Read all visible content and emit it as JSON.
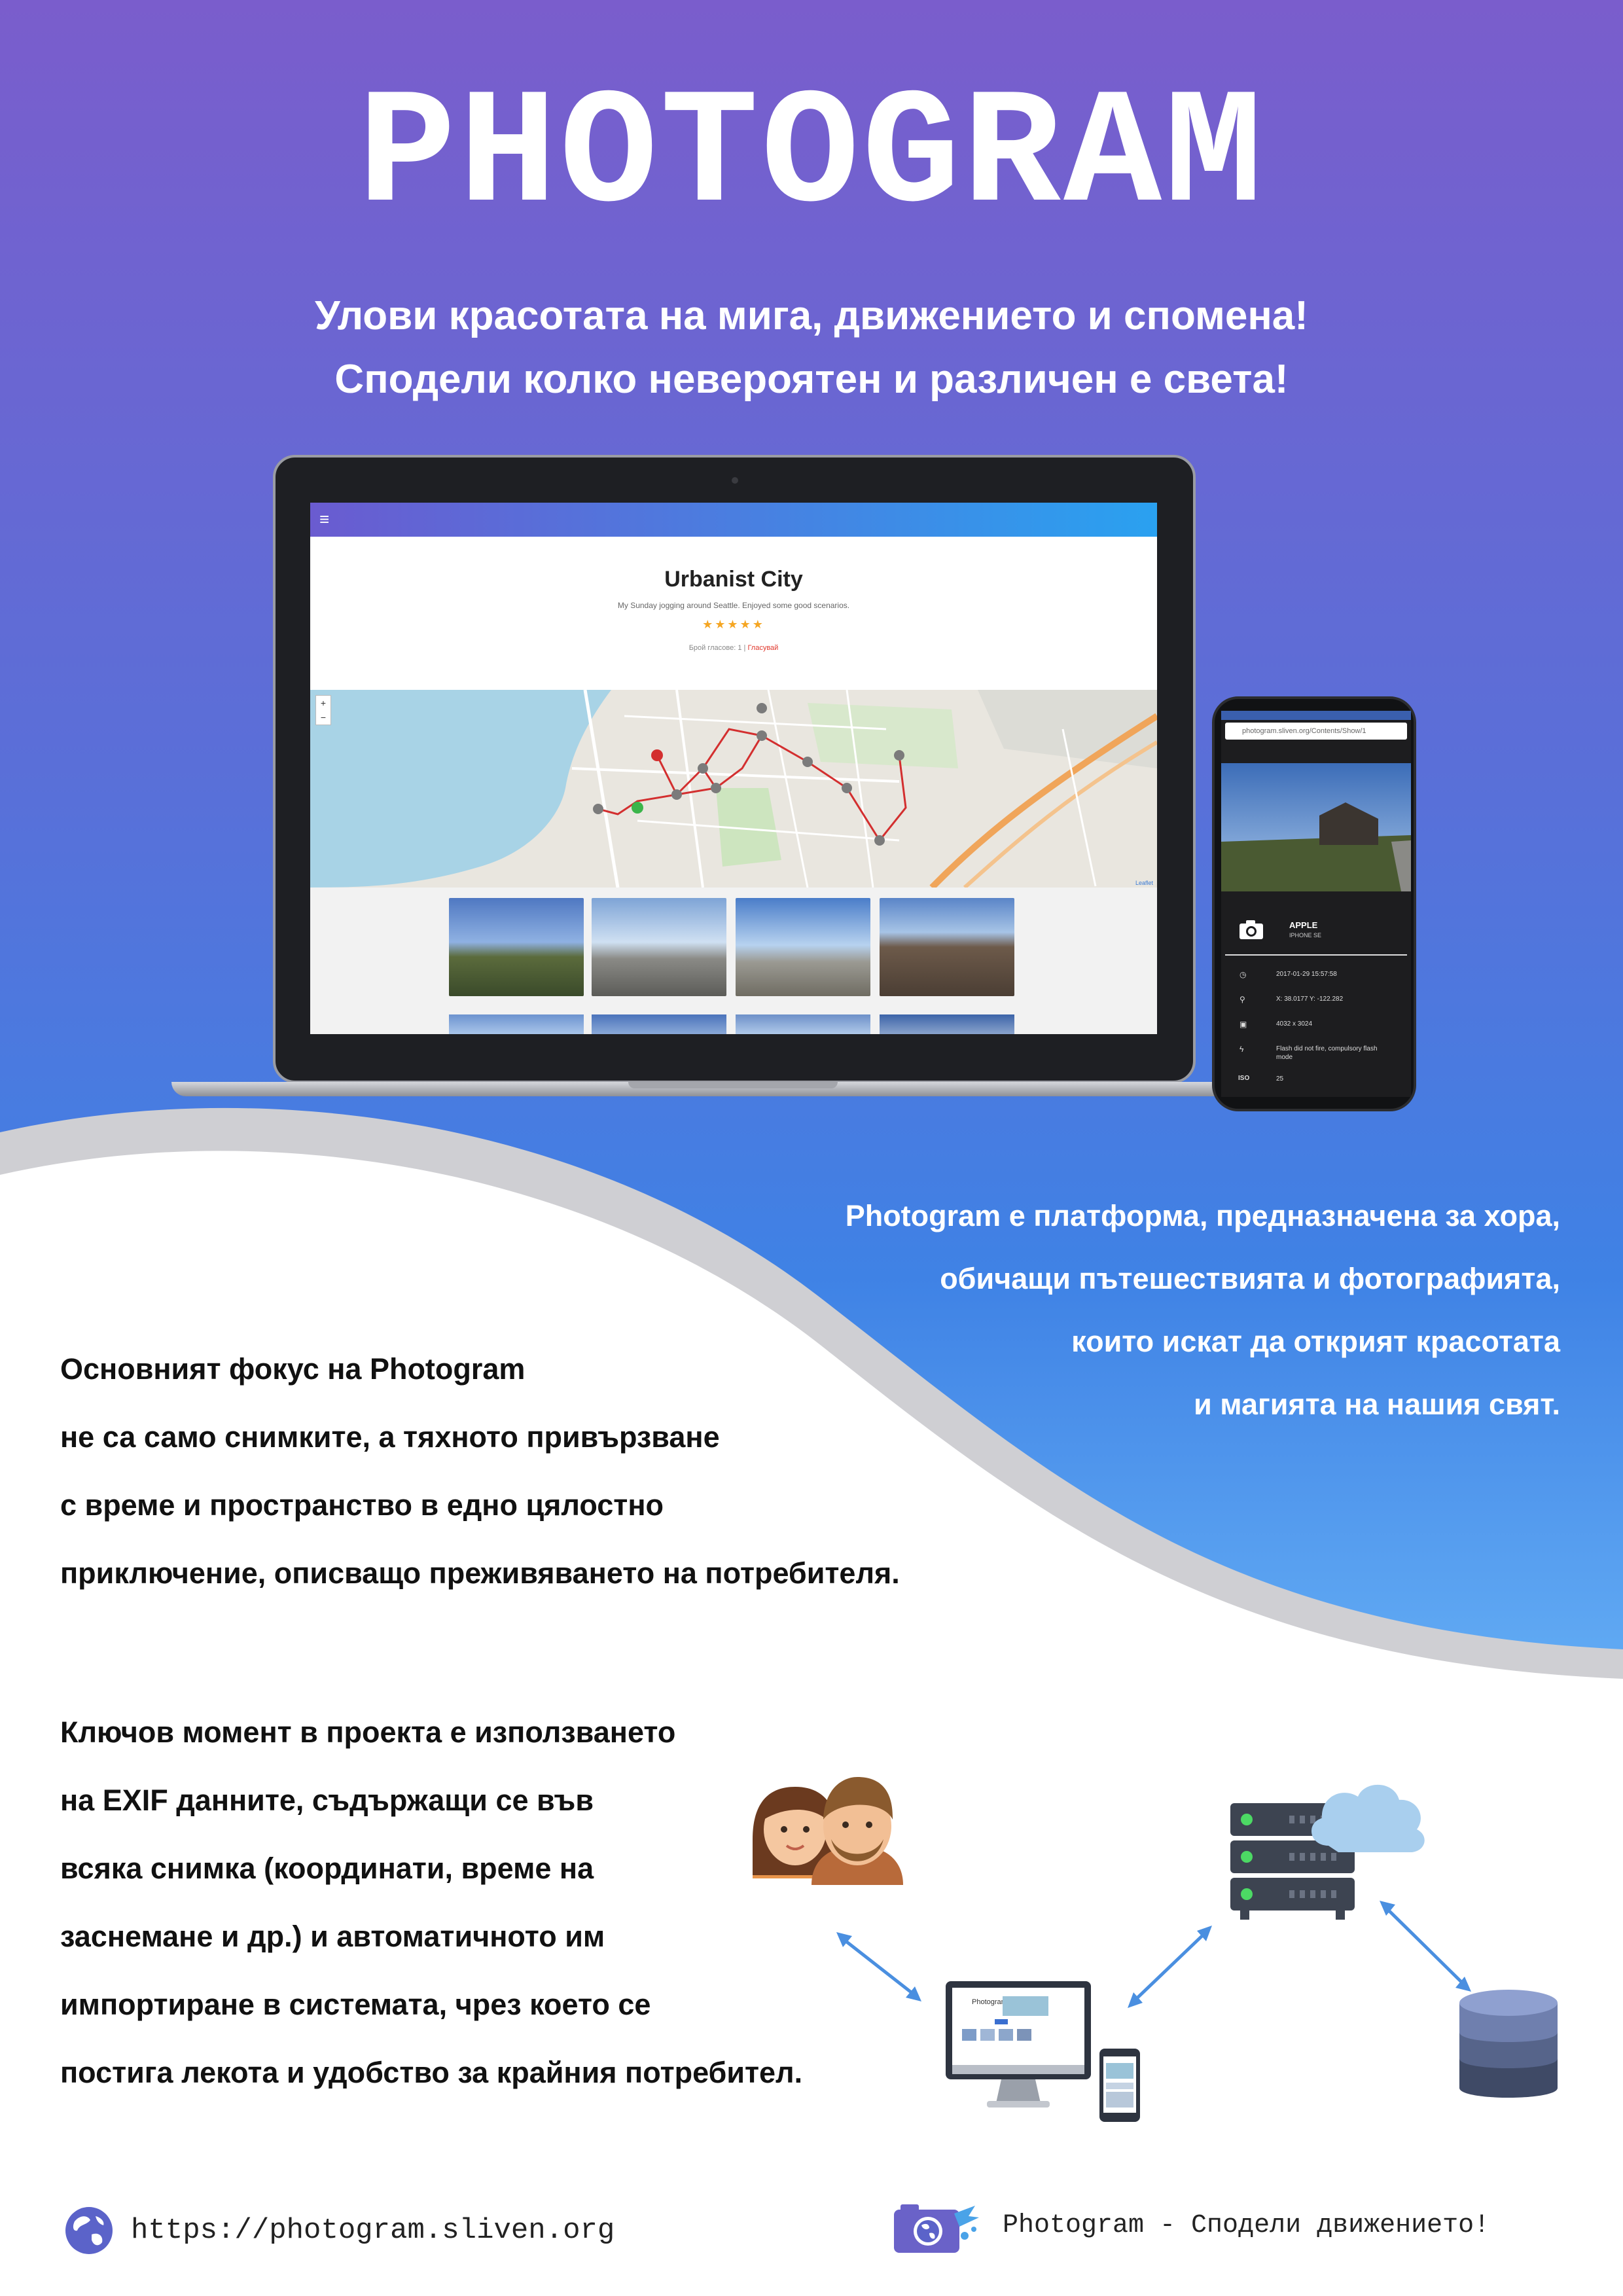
{
  "brand": {
    "title": "PHOTOGRAM",
    "tagline_1": "Улови красотата на мига, движението и спомена!",
    "tagline_2": "Сподели колко невероятен и различен е света!"
  },
  "laptop_screen": {
    "menu_icon": "≡",
    "page_title": "Urbanist City",
    "description": "My Sunday jogging around Seattle. Enjoyed some good scenarios.",
    "stars": "★★★★★",
    "rating": 5,
    "votes_label": "Брой гласове: 1",
    "votes_separator": " | ",
    "votes_link": "Гласувай",
    "zoom_in": "+",
    "zoom_out": "−",
    "map_attribution": "Leaflet",
    "scroll_top_icon": "˄"
  },
  "phone_screen": {
    "url": "photogram.sliven.org/Contents/Show/1",
    "camera_make": "APPLE",
    "camera_model": "IPHONE SE",
    "exif": {
      "datetime": "2017-01-29 15:57:58",
      "coordinates": "X: 38.0177 Y: -122.282",
      "resolution": "4032 x 3024",
      "flash": "Flash did not fire, compulsory flash mode",
      "iso_label": "ISO",
      "iso_value": "25"
    }
  },
  "platform_text": [
    "Photogram е платформа, предназначена за хора,",
    "обичащи пътешествията и фотографията,",
    "които искат да открият красотата",
    "и магията на нашия свят."
  ],
  "focus_text": [
    "Основният фокус на Photogram",
    "не са само снимките, а тяхното привързване",
    "с време и пространство в едно цялостно",
    "приключение, описващо преживяването на потребителя."
  ],
  "exif_text": [
    "Ключов момент в проекта е използването",
    "на EXIF данните, съдържащи се във",
    "всяка снимка (координати, време на",
    "заснемане и др.) и автоматичното им",
    "импортиране в системата, чрез което се",
    "постига лекота и удобство за крайния потребител."
  ],
  "diagram": {
    "mini_app_name": "Photogram",
    "icons": [
      "users-icon",
      "server-icon",
      "cloud-icon",
      "monitor-icon",
      "smartphone-icon",
      "database-icon",
      "double-arrow-icon"
    ]
  },
  "footer": {
    "url": "https://photogram.sliven.org",
    "slogan": "Photogram - Сподели движението!"
  },
  "colors": {
    "top_gradient_start": "#7a5dcc",
    "top_gradient_end": "#3f82e5",
    "wave_gray": "#cfcfd3",
    "text_dark": "#111111",
    "accent_red": "#d32f2f",
    "accent_green": "#3bb54a"
  }
}
